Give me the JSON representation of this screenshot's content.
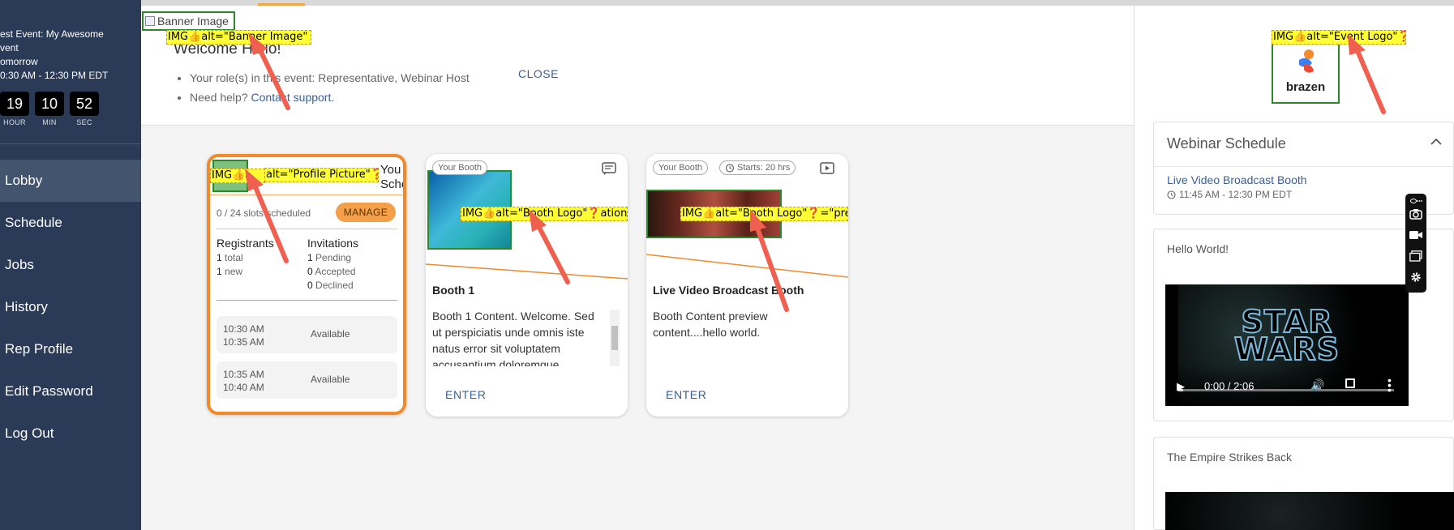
{
  "sidebar": {
    "event_line1": "est Event: My Awesome",
    "event_line2": "vent",
    "event_day": "omorrow",
    "event_time": "0:30 AM - 12:30 PM EDT",
    "countdown": [
      {
        "value": "19",
        "label": "HOUR"
      },
      {
        "value": "10",
        "label": "MIN"
      },
      {
        "value": "52",
        "label": "SEC"
      }
    ],
    "nav": [
      {
        "label": "Lobby",
        "active": true
      },
      {
        "label": "Schedule",
        "active": false
      },
      {
        "label": "Jobs",
        "active": false
      },
      {
        "label": "History",
        "active": false
      },
      {
        "label": "Rep Profile",
        "active": false
      },
      {
        "label": "Edit Password",
        "active": false
      },
      {
        "label": "Log Out",
        "active": false
      }
    ]
  },
  "welcome": {
    "banner_alt": "Banner Image",
    "title": "Welcome Hello!",
    "roles_text": "Your role(s) in this event: Representative, Webinar Host",
    "help_prefix": "Need help? ",
    "help_link": "Contact support.",
    "close_label": "CLOSE"
  },
  "schedule_card": {
    "title_line1": "You",
    "title_line2": "Sche",
    "slots_text": "0 / 24 slots scheduled",
    "manage_label": "MANAGE",
    "registrants": {
      "heading": "Registrants",
      "total_num": "1",
      "total_label": "total",
      "new_num": "1",
      "new_label": "new"
    },
    "invitations": {
      "heading": "Invitations",
      "pending_num": "1",
      "pending_label": "Pending",
      "accepted_num": "0",
      "accepted_label": "Accepted",
      "declined_num": "0",
      "declined_label": "Declined"
    },
    "slots": [
      {
        "start": "10:30 AM",
        "end": "10:35 AM",
        "status": "Available"
      },
      {
        "start": "10:35 AM",
        "end": "10:40 AM",
        "status": "Available"
      }
    ]
  },
  "booths": [
    {
      "pill": "Your Booth",
      "name": "Booth 1",
      "content": "Booth 1 Content. Welcome. Sed ut perspiciatis unde omnis iste natus error sit voluptatem accusantium doloremque",
      "enter": "ENTER",
      "icon": "chat-icon"
    },
    {
      "pill": "Your Booth",
      "starts": "Starts: 20 hrs",
      "name": "Live Video Broadcast Booth",
      "content": "Booth Content preview content....hello world.",
      "enter": "ENTER",
      "icon": "video-play-icon"
    }
  ],
  "right": {
    "logo_text": "brazen",
    "webinar_heading": "Webinar Schedule",
    "webinar_link": "Live Video Broadcast Booth",
    "webinar_time": "11:45 AM - 12:30 PM EDT",
    "video1_title": "Hello World!",
    "video1_time": "0:00 / 2:06",
    "video2_title": "The Empire Strikes Back",
    "sw_line1": "STAR",
    "sw_line2": "WARS"
  },
  "annotations": {
    "banner": "IMG👍alt=\"Banner Image\"❓",
    "profile_a": "IMG👍a",
    "profile_b": "alt=\"Profile Picture\"❓ation\"",
    "booth1": "IMG👍alt=\"Booth Logo\"❓ation\"",
    "booth2": "IMG👍alt=\"Booth Logo\"❓=\"prese",
    "event_logo": "IMG👍alt=\"Event Logo\"❓"
  },
  "colors": {
    "sidebar": "#2a3a57",
    "accent": "#f08a2a",
    "link": "#3a5f96",
    "annotation": "#ffff33",
    "arrow": "#f06050"
  }
}
